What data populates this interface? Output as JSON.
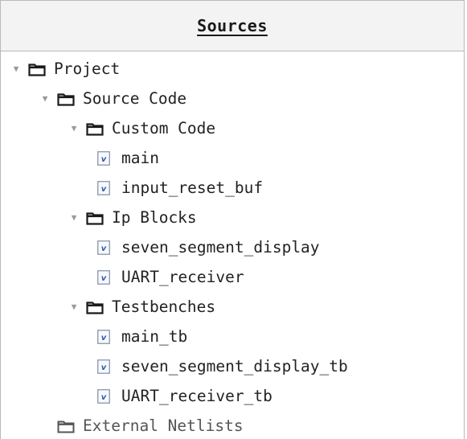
{
  "panel": {
    "title": "Sources"
  },
  "tree": [
    {
      "id": "project",
      "label": "Project",
      "kind": "folder",
      "expanded": true,
      "depth": 0
    },
    {
      "id": "source-code",
      "label": "Source Code",
      "kind": "folder",
      "expanded": true,
      "depth": 1
    },
    {
      "id": "custom-code",
      "label": "Custom Code",
      "kind": "folder",
      "expanded": true,
      "depth": 2
    },
    {
      "id": "main",
      "label": "main",
      "kind": "verilog-file",
      "depth": 3
    },
    {
      "id": "input-reset-buf",
      "label": "input_reset_buf",
      "kind": "verilog-file",
      "depth": 3
    },
    {
      "id": "ip-blocks",
      "label": "Ip Blocks",
      "kind": "folder",
      "expanded": true,
      "depth": 2
    },
    {
      "id": "seven-segment-display",
      "label": "seven_segment_display",
      "kind": "verilog-file",
      "depth": 3
    },
    {
      "id": "uart-receiver",
      "label": "UART_receiver",
      "kind": "verilog-file",
      "depth": 3
    },
    {
      "id": "testbenches",
      "label": "Testbenches",
      "kind": "folder",
      "expanded": true,
      "depth": 2
    },
    {
      "id": "main-tb",
      "label": "main_tb",
      "kind": "verilog-file",
      "depth": 3
    },
    {
      "id": "seven-segment-display-tb",
      "label": "seven_segment_display_tb",
      "kind": "verilog-file",
      "depth": 3
    },
    {
      "id": "uart-receiver-tb",
      "label": "UART_receiver_tb",
      "kind": "verilog-file",
      "depth": 3
    },
    {
      "id": "external-netlists",
      "label": "External Netlists",
      "kind": "folder",
      "expanded": false,
      "empty": true,
      "depth": 1
    }
  ],
  "icons": {
    "expand_arrow": "triangle-down-icon",
    "folder": "folder-icon",
    "verilog_file": "verilog-file-icon"
  },
  "colors": {
    "header_background": "#f3f3f3",
    "border": "#b9b9b9",
    "text": "#222222",
    "file_icon_accent": "#2b5aa8"
  }
}
